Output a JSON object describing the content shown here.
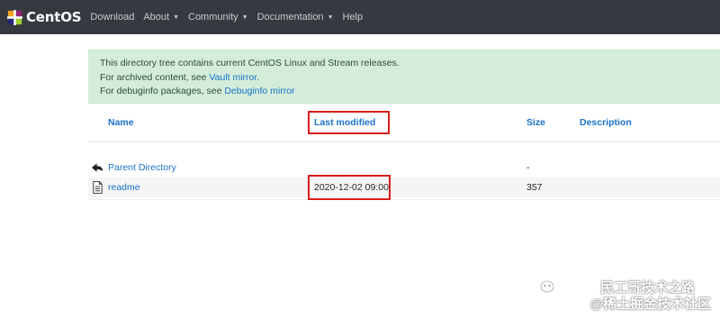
{
  "navbar": {
    "brand": "CentOS",
    "items": [
      {
        "label": "Download",
        "dropdown": false
      },
      {
        "label": "About",
        "dropdown": true
      },
      {
        "label": "Community",
        "dropdown": true
      },
      {
        "label": "Documentation",
        "dropdown": true
      },
      {
        "label": "Help",
        "dropdown": false
      }
    ]
  },
  "notice": {
    "line1": "This directory tree contains current CentOS Linux and Stream releases.",
    "line2_prefix": "For archived content, see ",
    "line2_link": "Vault mirror.",
    "line3_prefix": "For debuginfo packages, see ",
    "line3_link": "Debuginfo mirror"
  },
  "listing": {
    "columns": [
      "Name",
      "Last modified",
      "Size",
      "Description"
    ],
    "rows": [
      {
        "icon": "parent-directory-icon",
        "name": "Parent Directory",
        "modified": "",
        "size": "-",
        "description": ""
      },
      {
        "icon": "text-file-icon",
        "name": "readme",
        "modified": "2020-12-02 09:00",
        "size": "357",
        "description": ""
      }
    ]
  },
  "watermark": {
    "line1": "民工哥技术之路",
    "line2": "@稀土掘金技术社区"
  },
  "colors": {
    "navbar": "#343a40",
    "alert_bg": "#d4edda",
    "link": "#1a73c9",
    "highlight": "#d91c1c"
  }
}
